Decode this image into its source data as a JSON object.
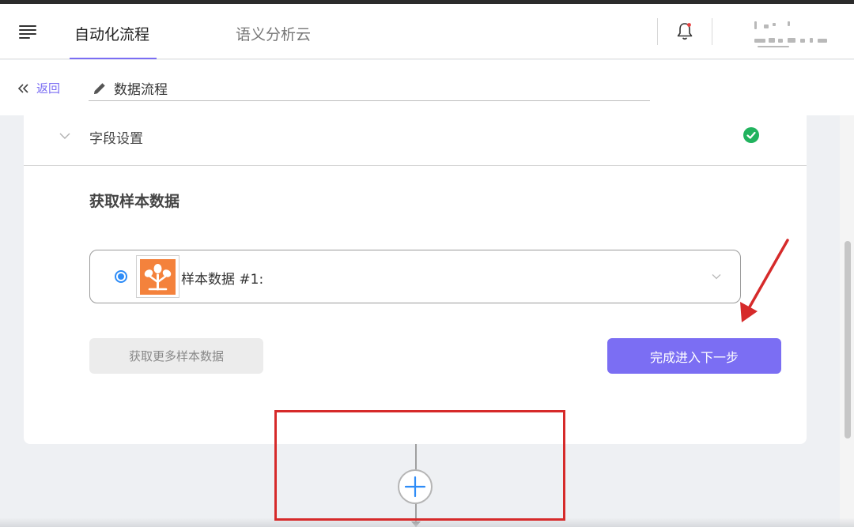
{
  "header": {
    "tabs": [
      {
        "label": "自动化流程",
        "active": true
      },
      {
        "label": "语义分析云",
        "active": false
      }
    ]
  },
  "subbar": {
    "back_label": "返回",
    "flow_name": "数据流程"
  },
  "section": {
    "title": "字段设置",
    "status": "complete"
  },
  "sample": {
    "heading": "获取样本数据",
    "selected_label": "样本数据 #1:",
    "more_button": "获取更多样本数据",
    "next_button": "完成进入下一步"
  },
  "colors": {
    "accent": "#7b6ef3",
    "success": "#21b35e",
    "radio": "#2e8cf7",
    "app_icon": "#f4823c",
    "annotation": "#d62a2a"
  },
  "icons": [
    "menu-icon",
    "bell-icon",
    "back-chevrons-icon",
    "pencil-icon",
    "chevron-down-icon",
    "check-circle-icon",
    "tree-app-icon",
    "plus-icon"
  ]
}
